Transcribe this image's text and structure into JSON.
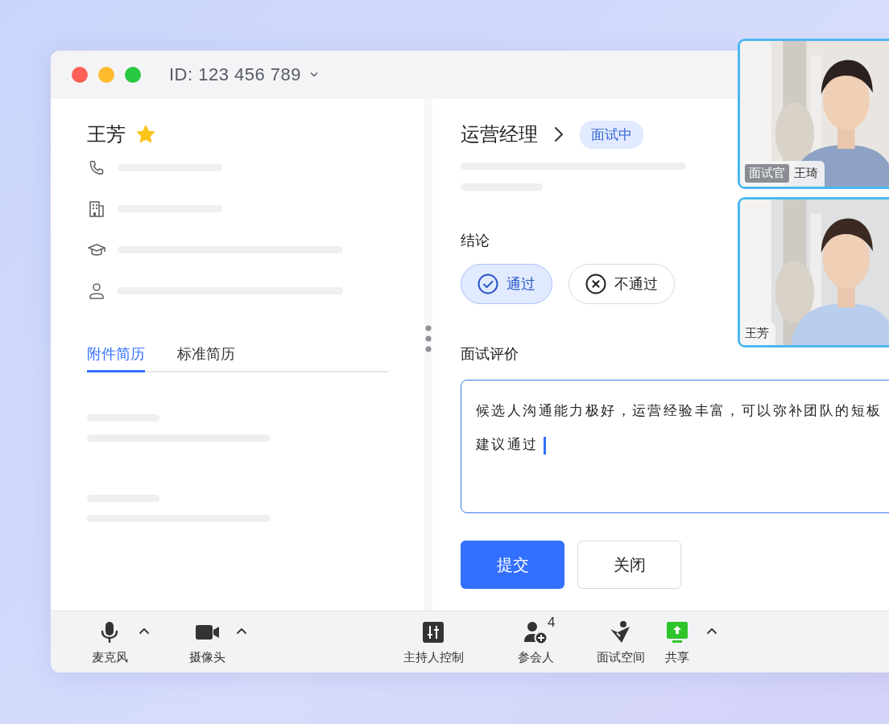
{
  "window": {
    "title": "ID: 123 456 789"
  },
  "candidate": {
    "name": "王芳",
    "starred": true
  },
  "contact_rows": [
    {
      "kind": "phone"
    },
    {
      "kind": "building"
    },
    {
      "kind": "education"
    },
    {
      "kind": "person"
    }
  ],
  "resume_tabs": [
    {
      "label": "附件简历",
      "selected": true
    },
    {
      "label": "标准简历",
      "selected": false
    }
  ],
  "position": {
    "title": "运营经理",
    "status": "面试中"
  },
  "conclusion": {
    "label": "结论",
    "options": [
      {
        "kind": "pass",
        "label": "通过",
        "selected": true
      },
      {
        "kind": "fail",
        "label": "不通过",
        "selected": false
      }
    ]
  },
  "evaluation": {
    "label": "面试评价",
    "lines": [
      "候选人沟通能力极好，运营经验丰富，可以弥补团队的短板",
      "建议通过"
    ]
  },
  "buttons": [
    {
      "kind": "primary",
      "label": "提交"
    },
    {
      "kind": "secondary",
      "label": "关闭"
    }
  ],
  "toolbar": [
    {
      "kind": "mic",
      "label": "麦克风",
      "menu": true
    },
    {
      "kind": "camera",
      "label": "摄像头",
      "menu": true
    },
    {
      "kind": "host",
      "label": "主持人控制",
      "menu": false
    },
    {
      "kind": "participants",
      "label": "参会人",
      "badge": "4",
      "menu": false
    },
    {
      "kind": "space",
      "label": "面试空间",
      "menu": false
    },
    {
      "kind": "share",
      "label": "共享",
      "menu": true
    }
  ],
  "video_tiles": [
    {
      "kind": "picture",
      "role": "面试官",
      "name": "王琦"
    },
    {
      "kind": "picture",
      "name": "王芳"
    }
  ]
}
